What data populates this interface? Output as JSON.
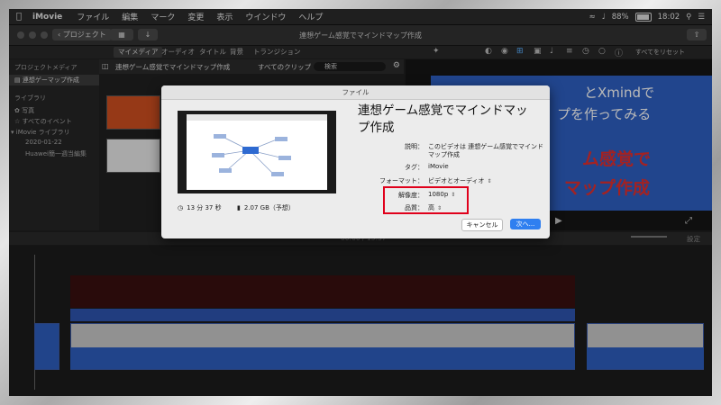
{
  "menubar": {
    "app": "iMovie",
    "items": [
      "ファイル",
      "編集",
      "マーク",
      "変更",
      "表示",
      "ウインドウ",
      "ヘルプ"
    ],
    "battery": "88%",
    "clock": "18:02"
  },
  "toolbar": {
    "back_label": "プロジェクト",
    "window_title": "連想ゲーム感覚でマインドマップ作成"
  },
  "tabs": [
    "マイメディア",
    "オーディオ",
    "タイトル",
    "背景",
    "トランジション"
  ],
  "viewer_reset": "すべてをリセット",
  "sidebar": {
    "section_project": "プロジェクトメディア",
    "project_item": "連想ゲーマップ作成",
    "section_library": "ライブラリ",
    "photos": "写真",
    "all_events": "すべてのイベント",
    "imovie_library": "iMovie ライブラリ",
    "date": "2020-01-22",
    "huawei": "Huawei簡一週当編集"
  },
  "browser": {
    "project_title": "連想ゲーム感覚でマインドマップ作成",
    "filter": "すべてのクリップ",
    "search_placeholder": "検索"
  },
  "viewer": {
    "line1": "とXmindで",
    "line2": "プを作ってみる",
    "line3": "ム感覚で",
    "line4": "マップ作成"
  },
  "timeline": {
    "timecode": "00:00 / 13:37",
    "settings": "設定"
  },
  "dialog": {
    "window_title": "ファイル",
    "heading": "連想ゲーム感覚でマインドマップ作成",
    "duration": "13 分 37 秒",
    "size": "2.07 GB（予想）",
    "description_label": "説明：",
    "description_value_line1": "このビデオは 連想ゲーム感覚でマインド",
    "description_value_line2": "マップ作成",
    "tag_label": "タグ：",
    "tag_value": "iMovie",
    "format_label": "フォーマット：",
    "format_value": "ビデオとオーディオ",
    "resolution_label": "解像度：",
    "resolution_value": "1080p",
    "quality_label": "品質：",
    "quality_value": "高",
    "cancel_label": "キャンセル",
    "next_label": "次へ..."
  },
  "colors": {
    "accent_blue": "#2f7ff0",
    "highlight_red": "#e0001b",
    "viewer_blue": "#2f60c4",
    "viewer_red_text": "#e23030"
  }
}
